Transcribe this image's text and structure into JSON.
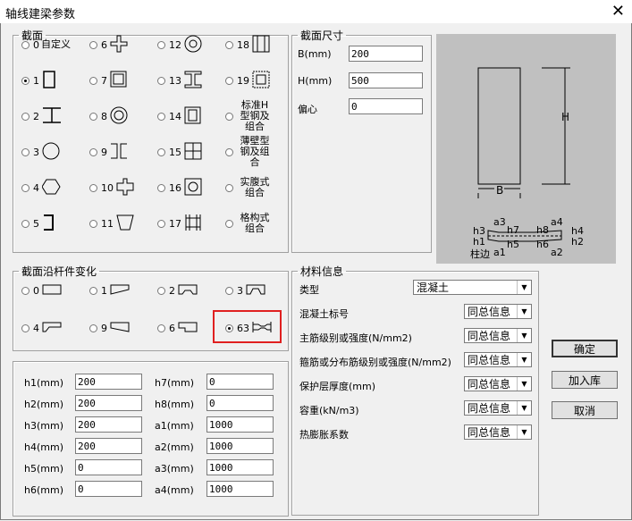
{
  "window": {
    "title": "轴线建梁参数"
  },
  "section": {
    "legend": "截面",
    "options": [
      {
        "num": "0",
        "label": "自定义"
      },
      {
        "num": "1"
      },
      {
        "num": "2"
      },
      {
        "num": "3"
      },
      {
        "num": "4"
      },
      {
        "num": "5"
      },
      {
        "num": "6"
      },
      {
        "num": "7"
      },
      {
        "num": "8"
      },
      {
        "num": "9"
      },
      {
        "num": "10"
      },
      {
        "num": "11"
      },
      {
        "num": "12"
      },
      {
        "num": "13"
      },
      {
        "num": "14"
      },
      {
        "num": "15"
      },
      {
        "num": "16"
      },
      {
        "num": "17"
      },
      {
        "num": "18"
      },
      {
        "num": "19"
      },
      {
        "label": "标准H型钢及组合"
      },
      {
        "label": "薄壁型钢及组合"
      },
      {
        "label": "实腹式组合"
      },
      {
        "label": "格构式组合"
      }
    ],
    "selected": "1"
  },
  "dims": {
    "legend": "截面尺寸",
    "fields": [
      {
        "label": "B(mm)",
        "value": "200"
      },
      {
        "label": "H(mm)",
        "value": "500"
      },
      {
        "label": "偏心",
        "value": "0"
      }
    ]
  },
  "preview": {
    "b": "B",
    "h": "H",
    "labels": {
      "h3": "h3",
      "h1": "h1",
      "h7": "h7",
      "h5": "h5",
      "h8": "h8",
      "h6": "h6",
      "h4": "h4",
      "h2": "h2",
      "a3": "a3",
      "a4": "a4",
      "a1": "a1",
      "a2": "a2",
      "col": "柱边"
    }
  },
  "variation": {
    "legend": "截面沿杆件变化",
    "options": [
      {
        "num": "0"
      },
      {
        "num": "1"
      },
      {
        "num": "2"
      },
      {
        "num": "3"
      },
      {
        "num": "4"
      },
      {
        "num": "9"
      },
      {
        "num": "6"
      },
      {
        "num": "63"
      }
    ],
    "selected": "63",
    "highlight_color": "#e02020"
  },
  "params": [
    {
      "label": "h1(mm)",
      "value": "200"
    },
    {
      "label": "h7(mm)",
      "value": "0"
    },
    {
      "label": "h2(mm)",
      "value": "200"
    },
    {
      "label": "h8(mm)",
      "value": "0"
    },
    {
      "label": "h3(mm)",
      "value": "200"
    },
    {
      "label": "a1(mm)",
      "value": "1000"
    },
    {
      "label": "h4(mm)",
      "value": "200"
    },
    {
      "label": "a2(mm)",
      "value": "1000"
    },
    {
      "label": "h5(mm)",
      "value": "0"
    },
    {
      "label": "a3(mm)",
      "value": "1000"
    },
    {
      "label": "h6(mm)",
      "value": "0"
    },
    {
      "label": "a4(mm)",
      "value": "1000"
    }
  ],
  "material": {
    "legend": "材料信息",
    "rows": [
      {
        "label": "类型",
        "value": "混凝土"
      },
      {
        "label": "混凝土标号",
        "value": "同总信息"
      },
      {
        "label": "主筋级别或强度(N/mm2)",
        "value": "同总信息"
      },
      {
        "label": "箍筋或分布筋级别或强度(N/mm2)",
        "value": "同总信息"
      },
      {
        "label": "保护层厚度(mm)",
        "value": "同总信息"
      },
      {
        "label": "容重(kN/m3)",
        "value": "同总信息"
      },
      {
        "label": "热膨胀系数",
        "value": "同总信息"
      }
    ]
  },
  "buttons": {
    "ok": "确定",
    "add": "加入库",
    "cancel": "取消"
  }
}
